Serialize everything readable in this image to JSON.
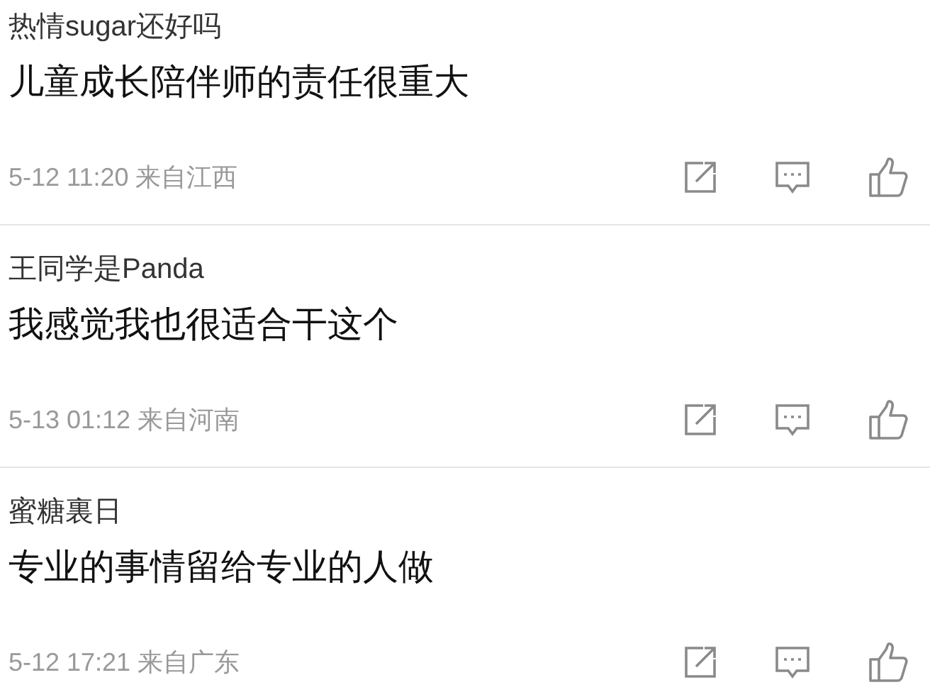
{
  "comments": [
    {
      "author": "热情sugar还好吗",
      "text": "儿童成长陪伴师的责任很重大",
      "meta": "5-12 11:20 来自江西"
    },
    {
      "author": "王同学是Panda",
      "text": "我感觉我也很适合干这个",
      "meta": "5-13 01:12 来自河南"
    },
    {
      "author": "蜜糖裏日",
      "text": "专业的事情留给专业的人做",
      "meta": "5-12 17:21 来自广东"
    }
  ]
}
